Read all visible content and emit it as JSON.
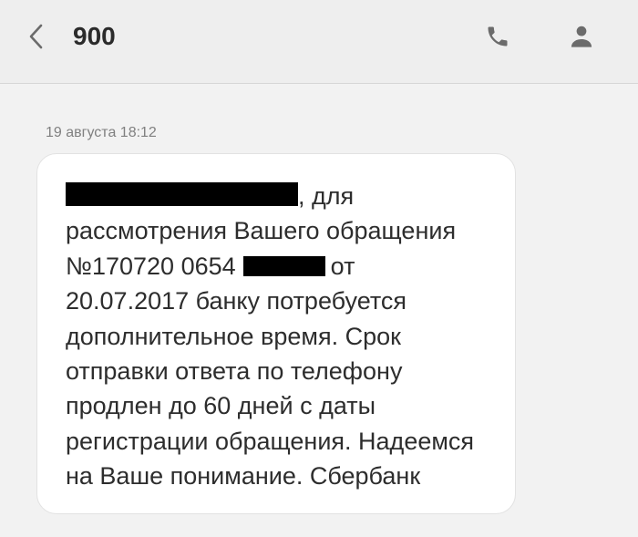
{
  "header": {
    "title": "900",
    "back_icon": "chevron-left-icon",
    "call_icon": "phone-icon",
    "contact_icon": "person-icon"
  },
  "message": {
    "timestamp": "19 августа 18:12",
    "lines": {
      "l1": ", для",
      "l2": "рассмотрения Вашего обращения",
      "l3a": "№170720 0654",
      "l3b": "от",
      "l4": "20.07.2017 банку потребуется",
      "l5": "дополнительное время. Срок",
      "l6": "отправки ответа по телефону",
      "l7": "продлен до 60 дней с даты",
      "l8": "регистрации обращения. Надеемся",
      "l9": "на Ваше понимание. Сбербанк"
    }
  },
  "colors": {
    "header_bg": "#eeeeee",
    "page_bg": "#f2f2f2",
    "bubble_bg": "#ffffff",
    "text": "#2d2d2d",
    "icon": "#6b6b6b"
  }
}
